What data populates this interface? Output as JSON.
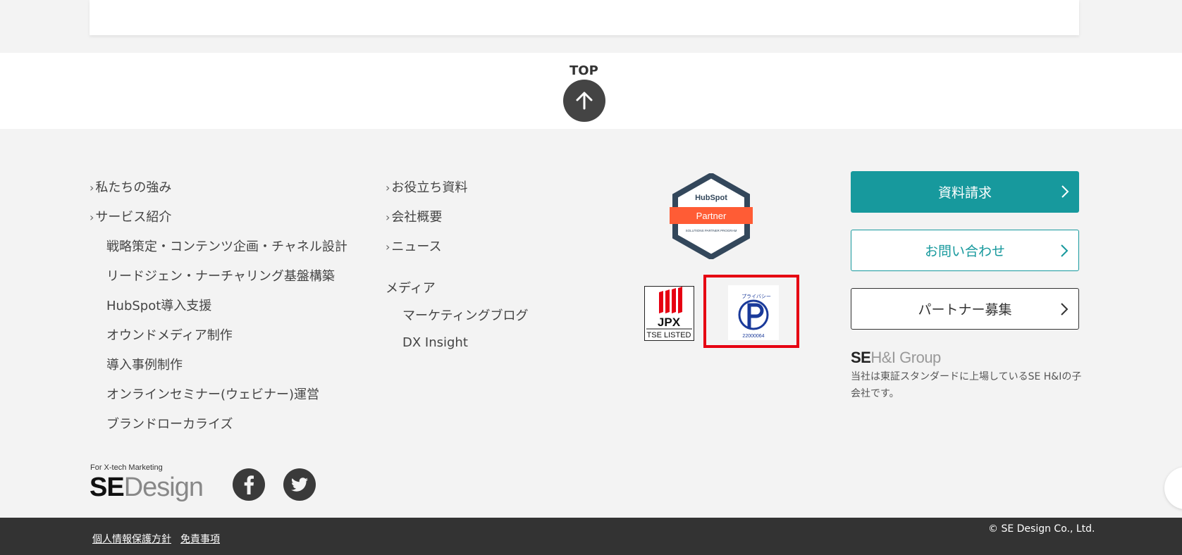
{
  "top": {
    "label": "TOP"
  },
  "nav_col1": [
    {
      "label": "私たちの強み",
      "chevron": true
    },
    {
      "label": "サービス紹介",
      "chevron": true
    },
    {
      "label": "戦略策定・コンテンツ企画・チャネル設計",
      "chevron": false
    },
    {
      "label": "リードジェン・ナーチャリング基盤構築",
      "chevron": false
    },
    {
      "label": "HubSpot導入支援",
      "chevron": false
    },
    {
      "label": "オウンドメディア制作",
      "chevron": false
    },
    {
      "label": "導入事例制作",
      "chevron": false
    },
    {
      "label": "オンラインセミナー(ウェビナー)運営",
      "chevron": false
    },
    {
      "label": "ブランドローカライズ",
      "chevron": false
    }
  ],
  "nav_col2": [
    {
      "label": "お役立ち資料",
      "chevron": true
    },
    {
      "label": "会社概要",
      "chevron": true
    },
    {
      "label": "ニュース",
      "chevron": true
    },
    {
      "label": "メディア",
      "chevron": false
    },
    {
      "label": "マーケティングブログ",
      "chevron": false
    },
    {
      "label": "DX Insight",
      "chevron": false
    }
  ],
  "badges": {
    "hubspot_brand": "HubSpot",
    "hubspot_partner": "Partner",
    "hubspot_program": "SOLUTIONS PARTNER PROGRAM",
    "jpx_text": "JPX",
    "jpx_listed": "TSE LISTED",
    "privacy_number": "22000064",
    "privacy_caption": "プライバシー"
  },
  "cta": {
    "request": "資料請求",
    "contact": "お問い合わせ",
    "partner": "パートナー募集"
  },
  "group": {
    "logo_se": "SE",
    "logo_hi": "H&I Group",
    "note": "当社は東証スタンダードに上場しているSE H&Iの子会社です。"
  },
  "brand": {
    "tagline": "For X-tech Marketing",
    "logo_se": "SE",
    "logo_design": "Design"
  },
  "footer": {
    "privacy_policy": "個人情報保護方針",
    "disclaimer": "免責事項",
    "copyright": "© SE Design Co., Ltd."
  },
  "colors": {
    "teal": "#17999d",
    "dark": "#333333",
    "hubspot_orange": "#ff5c35",
    "privacy_red": "#e60012"
  }
}
